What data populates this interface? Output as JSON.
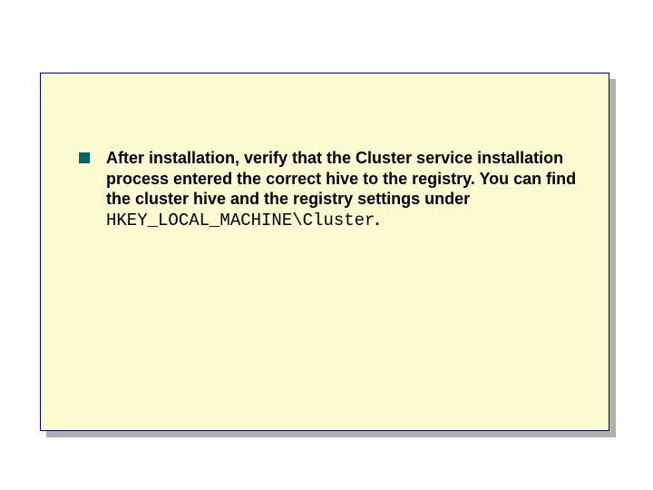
{
  "slide": {
    "bullet_icon": "square-bullet",
    "text_part1": "After installation, verify that the Cluster service installation process entered the correct hive to the registry. You can find the cluster hive and the registry settings under ",
    "registry_path": "HKEY_LOCAL_MACHINE\\Cluster",
    "text_part2": "."
  }
}
